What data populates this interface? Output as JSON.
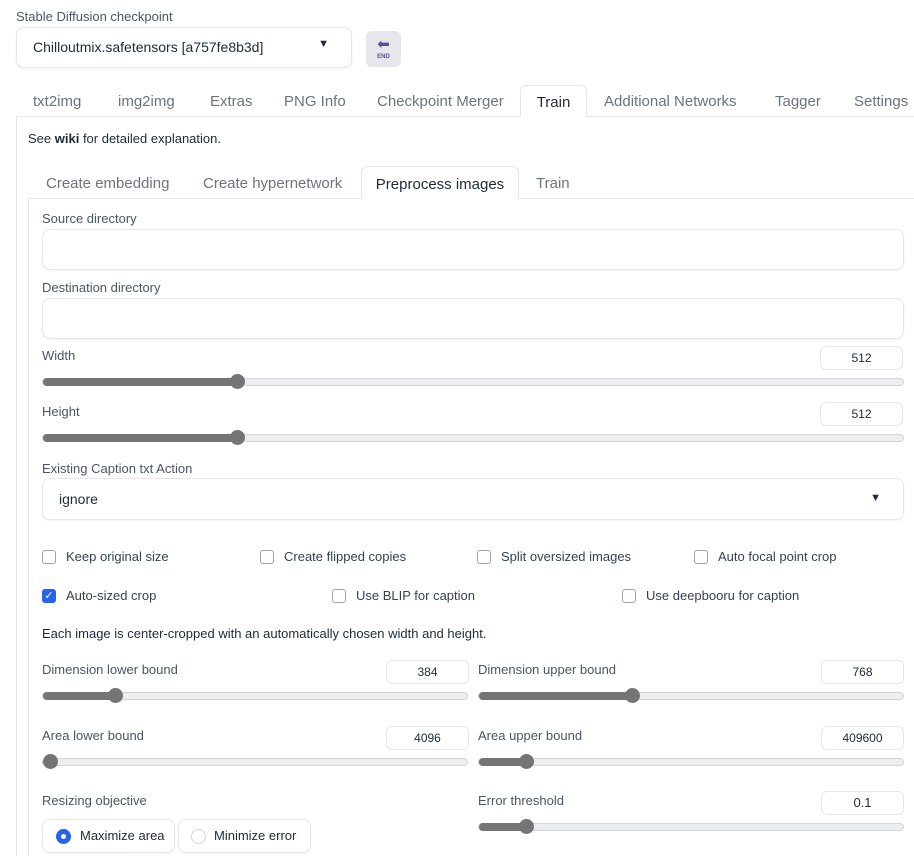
{
  "checkpoint": {
    "label": "Stable Diffusion checkpoint",
    "value": "Chilloutmix.safetensors [a757fe8b3d]"
  },
  "tabs": [
    "txt2img",
    "img2img",
    "Extras",
    "PNG Info",
    "Checkpoint Merger",
    "Train",
    "Additional Networks",
    "Tagger",
    "Settings"
  ],
  "active_tab": "Train",
  "wiki": {
    "pre": "See ",
    "link": "wiki",
    "post": " for detailed explanation."
  },
  "subtabs": [
    "Create embedding",
    "Create hypernetwork",
    "Preprocess images",
    "Train"
  ],
  "active_subtab": "Preprocess images",
  "source_label": "Source directory",
  "source_value": "",
  "dest_label": "Destination directory",
  "dest_value": "",
  "width": {
    "label": "Width",
    "value": "512",
    "fraction": 0.226
  },
  "height": {
    "label": "Height",
    "value": "512",
    "fraction": 0.226
  },
  "caption_action": {
    "label": "Existing Caption txt Action",
    "value": "ignore"
  },
  "checkboxes": [
    {
      "label": "Keep original size",
      "checked": false
    },
    {
      "label": "Create flipped copies",
      "checked": false
    },
    {
      "label": "Split oversized images",
      "checked": false
    },
    {
      "label": "Auto focal point crop",
      "checked": false
    },
    {
      "label": "Auto-sized crop",
      "checked": true
    },
    {
      "label": "Use BLIP for caption",
      "checked": false
    },
    {
      "label": "Use deepbooru for caption",
      "checked": false
    }
  ],
  "autosize_note": "Each image is center-cropped with an automatically chosen width and height.",
  "dim_lower": {
    "label": "Dimension lower bound",
    "value": "384",
    "fraction": 0.17
  },
  "dim_upper": {
    "label": "Dimension upper bound",
    "value": "768",
    "fraction": 0.36
  },
  "area_lower": {
    "label": "Area lower bound",
    "value": "4096",
    "fraction": 0.0
  },
  "area_upper": {
    "label": "Area upper bound",
    "value": "409600",
    "fraction": 0.11
  },
  "resizing": {
    "label": "Resizing objective",
    "options": [
      "Maximize area",
      "Minimize error"
    ],
    "selected": "Maximize area"
  },
  "error_threshold": {
    "label": "Error threshold",
    "value": "0.1",
    "fraction": 0.11
  },
  "colors": {
    "accent": "#2563eb",
    "slider": "#757575"
  }
}
